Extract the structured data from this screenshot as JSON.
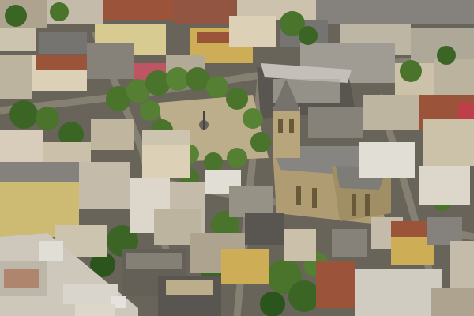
{
  "image": {
    "kind": "aerial photograph",
    "colors": {
      "ground": "#6f6a5e",
      "church_stone": "#b9a57a",
      "church_roof": "#8f8d89",
      "tree_green": "#4e7a2e",
      "tree_dark": "#2f5a20",
      "plaza": "#c7b893",
      "roof_red": "#a4583e",
      "roof_gray": "#7d7b76",
      "facade_cream": "#e8dcc0",
      "facade_yellow": "#d9b85b"
    }
  }
}
